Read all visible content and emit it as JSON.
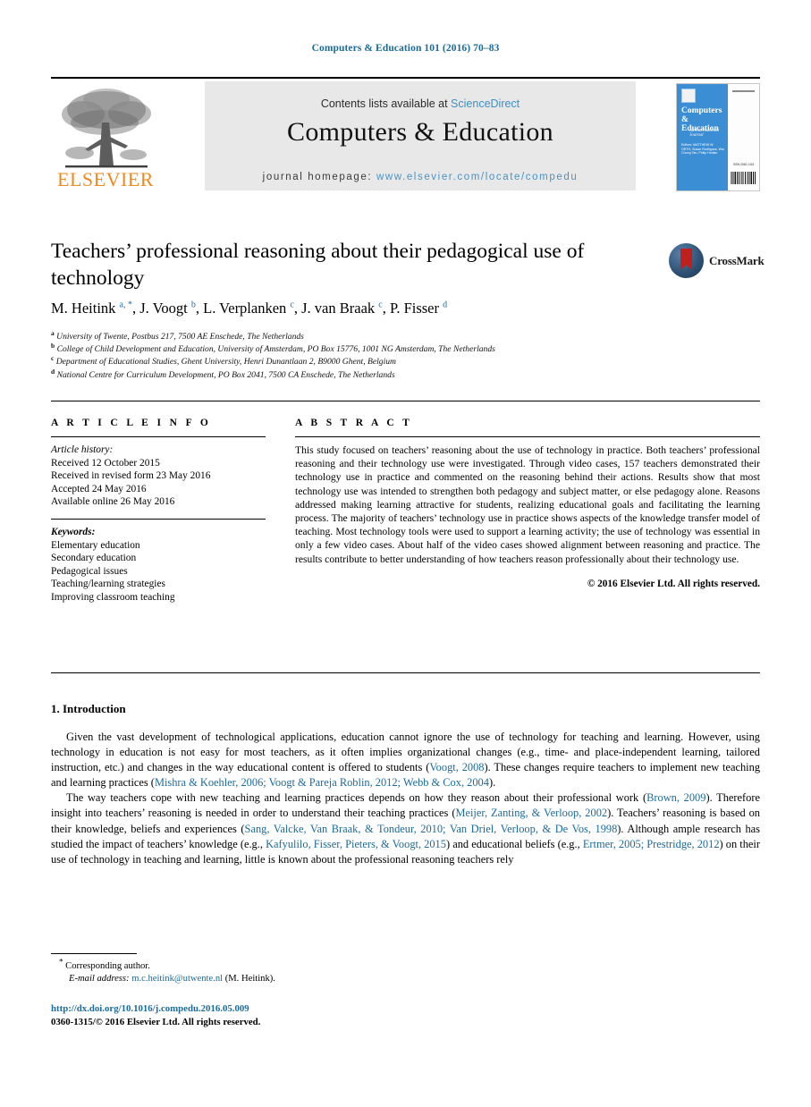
{
  "running_head": "Computers & Education 101 (2016) 70–83",
  "masthead": {
    "contents_prefix": "Contents lists available at ",
    "sciencedirect": "ScienceDirect",
    "journal_title": "Computers & Education",
    "homepage_prefix": "journal homepage: ",
    "homepage_url": "www.elsevier.com/locate/compedu",
    "publisher_logo_label": "ELSEVIER",
    "accent_link_color": "#3f8fc4",
    "cover": {
      "title": "Computers & Education",
      "subtitle": "An International Journal",
      "editors": "Editors: MATTHEW W. ORTH, Susan Rodrigues, Wai Chong Tan, Philip Hodkin",
      "issn_label": "ISSN 0360-1315",
      "panel_color": "#3c8ed4"
    }
  },
  "article": {
    "title": "Teachers’ professional reasoning about their pedagogical use of technology",
    "crossmark_label": "CrossMark",
    "authors": [
      {
        "name": "M. Heitink",
        "marks": "a, *"
      },
      {
        "name": "J. Voogt",
        "marks": "b"
      },
      {
        "name": "L. Verplanken",
        "marks": "c"
      },
      {
        "name": "J. van Braak",
        "marks": "c"
      },
      {
        "name": "P. Fisser",
        "marks": "d"
      }
    ],
    "affiliations": [
      {
        "mark": "a",
        "text": "University of Twente, Postbus 217, 7500 AE Enschede, The Netherlands"
      },
      {
        "mark": "b",
        "text": "College of Child Development and Education, University of Amsterdam, PO Box 15776, 1001 NG Amsterdam, The Netherlands"
      },
      {
        "mark": "c",
        "text": "Department of Educational Studies, Ghent University, Henri Dunantlaan 2, B9000 Ghent, Belgium"
      },
      {
        "mark": "d",
        "text": "National Centre for Curriculum Development, PO Box 2041, 7500 CA Enschede, The Netherlands"
      }
    ]
  },
  "article_info": {
    "heading": "A R T I C L E   I N F O",
    "history_label": "Article history:",
    "history": [
      "Received 12 October 2015",
      "Received in revised form 23 May 2016",
      "Accepted 24 May 2016",
      "Available online 26 May 2016"
    ],
    "keywords_label": "Keywords:",
    "keywords": [
      "Elementary education",
      "Secondary education",
      "Pedagogical issues",
      "Teaching/learning strategies",
      "Improving classroom teaching"
    ]
  },
  "abstract": {
    "heading": "A B S T R A C T",
    "text": "This study focused on teachers’ reasoning about the use of technology in practice. Both teachers’ professional reasoning and their technology use were investigated. Through video cases, 157 teachers demonstrated their technology use in practice and commented on the reasoning behind their actions. Results show that most technology use was intended to strengthen both pedagogy and subject matter, or else pedagogy alone. Reasons addressed making learning attractive for students, realizing educational goals and facilitating the learning process. The majority of teachers’ technology use in practice shows aspects of the knowledge transfer model of teaching. Most technology tools were used to support a learning activity; the use of technology was essential in only a few video cases. About half of the video cases showed alignment between reasoning and practice. The results contribute to better understanding of how teachers reason professionally about their technology use.",
    "copyright": "© 2016 Elsevier Ltd. All rights reserved."
  },
  "body": {
    "section_number_title": "1. Introduction",
    "paragraph_1_parts": [
      {
        "type": "text",
        "value": "Given the vast development of technological applications, education cannot ignore the use of technology for teaching and learning. However, using technology in education is not easy for most teachers, as it often implies organizational changes (e.g., time- and place-independent learning, tailored instruction, etc.) and changes in the way educational content is offered to students ("
      },
      {
        "type": "cite",
        "value": "Voogt, 2008"
      },
      {
        "type": "text",
        "value": "). These changes require teachers to implement new teaching and learning practices ("
      },
      {
        "type": "cite",
        "value": "Mishra & Koehler, 2006; Voogt & Pareja Roblin, 2012; Webb & Cox, 2004"
      },
      {
        "type": "text",
        "value": ")."
      }
    ],
    "paragraph_2_parts": [
      {
        "type": "text",
        "value": "The way teachers cope with new teaching and learning practices depends on how they reason about their professional work ("
      },
      {
        "type": "cite",
        "value": "Brown, 2009"
      },
      {
        "type": "text",
        "value": "). Therefore insight into teachers’ reasoning is needed in order to understand their teaching practices ("
      },
      {
        "type": "cite",
        "value": "Meijer, Zanting, & Verloop, 2002"
      },
      {
        "type": "text",
        "value": "). Teachers’ reasoning is based on their knowledge, beliefs and experiences ("
      },
      {
        "type": "cite",
        "value": "Sang, Valcke, Van Braak, & Tondeur, 2010; Van Driel, Verloop, & De Vos, 1998"
      },
      {
        "type": "text",
        "value": "). Although ample research has studied the impact of teachers’ knowledge (e.g., "
      },
      {
        "type": "cite",
        "value": "Kafyulilo, Fisser, Pieters, & Voogt, 2015"
      },
      {
        "type": "text",
        "value": ") and educational beliefs (e.g., "
      },
      {
        "type": "cite",
        "value": "Ertmer, 2005; Prestridge, 2012"
      },
      {
        "type": "text",
        "value": ") on their use of technology in teaching and learning, little is known about the professional reasoning teachers rely"
      }
    ]
  },
  "footer": {
    "corresponding_marker": "*",
    "corresponding_label": "Corresponding author.",
    "email_label": "E-mail address:",
    "email": "m.c.heitink@utwente.nl",
    "email_owner": "(M. Heitink).",
    "doi": "http://dx.doi.org/10.1016/j.compedu.2016.05.009",
    "issn_copyright": "0360-1315/© 2016 Elsevier Ltd. All rights reserved."
  }
}
